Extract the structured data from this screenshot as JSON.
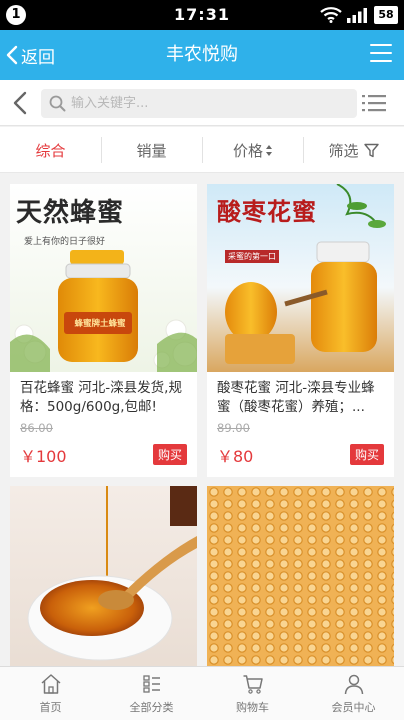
{
  "status_bar": {
    "notification_count": "1",
    "time": "17:31",
    "battery": "58"
  },
  "header": {
    "back_label": "返回",
    "title": "丰农悦购"
  },
  "search": {
    "placeholder": "输入关键字..."
  },
  "sort_tabs": {
    "comprehensive": "综合",
    "sales": "销量",
    "price": "价格",
    "filter": "筛选"
  },
  "products": [
    {
      "name": "百花蜂蜜 河北-滦县发货,规格：500g/600g,包邮!",
      "old_price": "86.00",
      "price": "￥100",
      "buy_label": "购买",
      "image_text": "天然蜂蜜",
      "image_subtext": "爱上有你的日子很好",
      "jar_label": "蜂蜜牌土蜂蜜"
    },
    {
      "name": "酸枣花蜜 河北-滦县专业蜂蜜（酸枣花蜜）养殖；...",
      "old_price": "89.00",
      "price": "￥80",
      "buy_label": "购买",
      "image_text": "酸枣花蜜",
      "image_subtext": "采蜜的第一口"
    },
    {
      "name": "",
      "old_price": "",
      "price": "",
      "buy_label": ""
    },
    {
      "name": "",
      "old_price": "",
      "price": "",
      "buy_label": ""
    }
  ],
  "bottom_nav": {
    "home": "首页",
    "categories": "全部分类",
    "cart": "购物车",
    "member": "会员中心"
  },
  "colors": {
    "header": "#2fb1ea",
    "accent": "#e4393c"
  }
}
